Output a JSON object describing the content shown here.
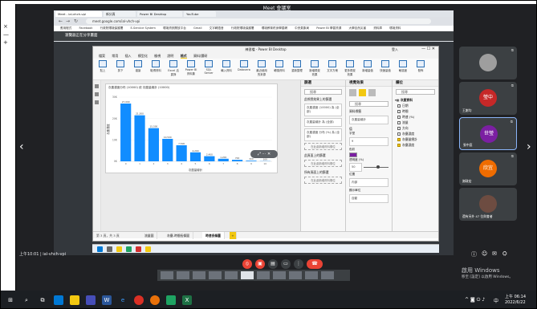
{
  "meet": {
    "window_title": "Meet 會議室",
    "top_caption": "我在網頁分享",
    "time_code": "上午10:01 | ial-vhch-vpi",
    "leftbar": [
      "×",
      "—",
      "+",
      "↖"
    ],
    "left_arrow": "‹",
    "right_arrow": "›"
  },
  "browser": {
    "tabs": [
      "Meet - ial-vhch-vpi",
      "新分頁",
      "Power BI Desktop",
      "YouTube"
    ],
    "address": "meet.google.com/ial-vhch-vpi",
    "bookmarks": [
      "應用程式",
      "Facebook",
      "行政院環境保護署",
      "E-Service System",
      "環境資訊開放平台",
      "Gmail",
      "文字轉語音",
      "行政院環境保護署",
      "環境教育終身學習網",
      "中央氣象局",
      "Power BI 學習資源",
      "大學自然災害",
      "資料庫",
      "環境資料"
    ],
    "share_banner": "瀏覽器正在分享畫面"
  },
  "pbi": {
    "title": "練習檔 - Power BI Desktop",
    "user": "登入",
    "menu": [
      "檔案",
      "常用",
      "插入",
      "模型化",
      "檢視",
      "說明",
      "格式",
      "資料/鑽研"
    ],
    "menu_active_index": 6,
    "ribbon": [
      "貼上",
      "剪下",
      "複製",
      "取得資料",
      "Excel 活頁簿",
      "Power BI 資料集",
      "SQL Server",
      "輸入資料",
      "Dataverse",
      "最近使用的來源",
      "轉換資料",
      "重新整理",
      "新增視覺效果",
      "文字方塊",
      "更多視覺效果",
      "新增量值",
      "快速量值",
      "敏感度",
      "發佈"
    ],
    "pages": [
      "流量圖",
      "灰塵-時間長條圖",
      "時速長條圖"
    ],
    "page_active_index": 2,
    "add_page": "+",
    "page_counter": "第 3 頁，共 3 頁"
  },
  "fields_pane": {
    "header": "欄位",
    "search": "搜尋",
    "table": "灰塵資料",
    "items": [
      "日期",
      "時間",
      "時速 (%)",
      "流量",
      "方向",
      "灰塵濃度",
      "灰塵量總計",
      "灰塵濃度"
    ],
    "checked": [
      false,
      false,
      false,
      false,
      false,
      false,
      true,
      true
    ]
  },
  "filters_pane": {
    "header": "篩選",
    "search": "搜尋",
    "visual_filter": "此視覺效果上的篩選",
    "well1": "灰塵濃度 (10000) 為 (全部)",
    "well2": "灰塵量總計 為 (全部)",
    "well3": "灰塵濃度 分布 (%) 為 (全部)",
    "add_data": "在此處新增資料欄位",
    "page_filter": "此頁面上的篩選",
    "all_filter": "所有頁面上的篩選"
  },
  "viz_pane": {
    "header": "視覺效果",
    "search": "搜尋",
    "section_value": "值",
    "font_label": "字型",
    "font_value": "9",
    "color_label": "色彩",
    "color_value": "#7b1fa2",
    "transparency_label": "透明度 (%)",
    "transparency_value": "50",
    "position_label": "位置",
    "position_value": "內部",
    "section_label": "資料標籤",
    "text_field": "灰塵量總計",
    "units_label": "顯示單位",
    "units_value": "自動"
  },
  "participants": [
    {
      "name": "",
      "kind": "photo"
    },
    {
      "name": "王謝均",
      "kind": "letter",
      "letter": "瑩中",
      "color": "#c62828"
    },
    {
      "name": "張中庭",
      "kind": "letter",
      "letter": "世瑩",
      "color": "#7b1fa2"
    },
    {
      "name": "謝政宏",
      "kind": "letter",
      "letter": "欣宜",
      "color": "#ef6c00"
    },
    {
      "name": "還有另外 47 位與會者",
      "kind": "group"
    }
  ],
  "controls": [
    "mic-off",
    "cam-off",
    "captions",
    "present",
    "more",
    "end-call"
  ],
  "windows_watermark": {
    "line1": "啟用 Windows",
    "line2": "移至 [設定] 以啟用 Windows。"
  },
  "taskbar": {
    "time": "上午 06:14",
    "date": "2022/6/22",
    "tray_lang": "中"
  },
  "chart_data": {
    "type": "bar",
    "title": "灰塵濃度分布 (10000) 依 灰塵量總計 (10000)",
    "categories": [
      "0",
      "1",
      "2",
      "3",
      "4",
      "5",
      "6",
      "7",
      "8",
      "9",
      "10"
    ],
    "values": [
      27000,
      21500,
      15500,
      10500,
      7500,
      4200,
      2400,
      1200,
      700,
      300,
      100
    ],
    "value_labels": [
      "27,000",
      "21,500",
      "15,500",
      "10,500",
      "7,500",
      "4,200",
      "2,400",
      "1,200",
      "700",
      "300",
      "100"
    ],
    "xlabel": "灰塵量總計",
    "ylabel": "灰塵濃度",
    "ylim": [
      0,
      30000
    ],
    "color": "#118dff"
  }
}
